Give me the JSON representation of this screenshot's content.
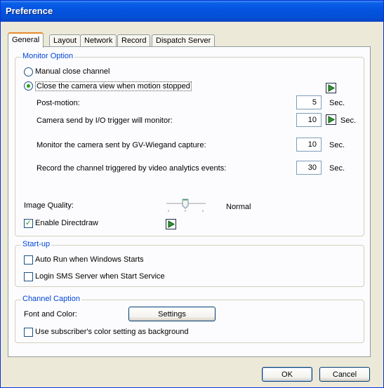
{
  "window": {
    "title": "Preference"
  },
  "tabs": [
    {
      "label": "General",
      "active": true
    },
    {
      "label": "Layout"
    },
    {
      "label": "Network"
    },
    {
      "label": "Record"
    },
    {
      "label": "Dispatch Server"
    }
  ],
  "monitor": {
    "title": "Monitor Option",
    "manual_close": "Manual close channel",
    "close_on_motion": "Close the camera view when motion stopped",
    "selected": "close_on_motion",
    "post_motion": {
      "label": "Post-motion:",
      "value": "5",
      "unit": "Sec."
    },
    "io_trigger": {
      "label": "Camera send by I/O trigger will monitor:",
      "value": "10",
      "unit": "Sec."
    },
    "wiegand": {
      "label": "Monitor the camera sent by GV-Wiegand capture:",
      "value": "10",
      "unit": "Sec."
    },
    "video_analytics": {
      "label": "Record the channel triggered by video analytics events:",
      "value": "30",
      "unit": "Sec."
    },
    "image_quality": {
      "label": "Image Quality:",
      "value_label": "Normal"
    },
    "directdraw": {
      "label": "Enable Directdraw",
      "checked": true
    }
  },
  "startup": {
    "title": "Start-up",
    "auto_run": {
      "label": "Auto Run when Windows Starts",
      "checked": false
    },
    "login_sms": {
      "label": "Login SMS Server when Start Service",
      "checked": false
    }
  },
  "caption": {
    "title": "Channel Caption",
    "font_color_label": "Font and Color:",
    "settings_button": "Settings",
    "subscriber": {
      "label": "Use subscriber's color setting as background",
      "checked": false
    }
  },
  "footer": {
    "ok": "OK",
    "cancel": "Cancel"
  },
  "colors": {
    "accent": "#0046d5",
    "check": "#21a121",
    "title_bar": "#0453de"
  }
}
